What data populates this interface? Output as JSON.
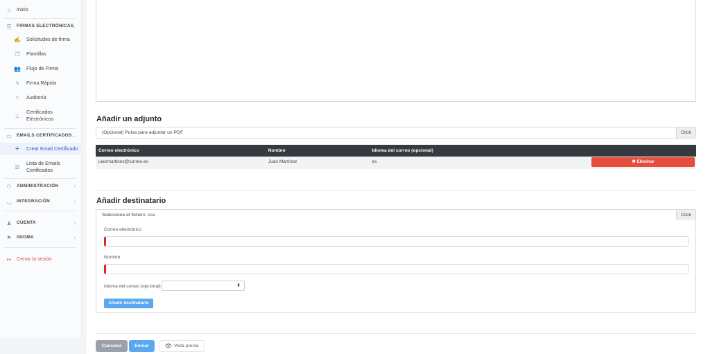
{
  "sidebar": {
    "items": [
      {
        "label": "Inicio",
        "icon": "home-icon"
      },
      {
        "label": "FIRMAS ELECTRÓNICAS",
        "icon": "list-icon"
      },
      {
        "label": "Solicitudes de firma",
        "icon": "signature-icon"
      },
      {
        "label": "Plantillas",
        "icon": "copy-icon"
      },
      {
        "label": "Flujo de Firma",
        "icon": "users-icon"
      },
      {
        "label": "Firma Rápida",
        "icon": "bolt-icon"
      },
      {
        "label": "Auditoría",
        "icon": "search-icon"
      },
      {
        "label": "Certificados Electrónicos",
        "icon": "certificate-icon"
      },
      {
        "label": "EMAILS CERTIFICADOS",
        "icon": "envelope-icon"
      },
      {
        "label": "Crear Email Certificado",
        "icon": "plus-icon"
      },
      {
        "label": "Lista de Emails Certificados",
        "icon": "list-icon"
      },
      {
        "label": "ADMINISTRACIÓN",
        "icon": "user-cog-icon"
      },
      {
        "label": "INTEGRACIÓN",
        "icon": "shield-icon"
      },
      {
        "label": "CUENTA",
        "icon": "user-icon"
      },
      {
        "label": "IDIOMA",
        "icon": "flag-icon"
      },
      {
        "label": "Cerrar la sesión",
        "icon": "logout-icon"
      }
    ]
  },
  "attachment": {
    "title": "Añadir un adjunto",
    "placeholder": "(Opcional) Pulsa para adjuntar un PDF",
    "button": "Click"
  },
  "recipients_table": {
    "headers": [
      "Correo electrónico",
      "Nombre",
      "Idioma del correo (opcional)",
      ""
    ],
    "rows": [
      {
        "email": "juanmartinez@correo.es",
        "name": "Juan Martínez",
        "language": "es",
        "action": "✖ Eliminar"
      }
    ]
  },
  "add_recipient": {
    "title": "Añadir destinatario",
    "file_placeholder": "Seleccione el fichero .csv",
    "button": "Click",
    "email_label": "Correo electrónico",
    "name_label": "Nombre",
    "language_label": "Idioma del correo (opcional)",
    "language_value": "",
    "submit": "Añadir destinatario"
  },
  "footer": {
    "cancel": "Cancelar",
    "send": "Enviar",
    "preview": "Vista previa"
  },
  "colors": {
    "accent": "#5aa9f0",
    "danger": "#e74c3c",
    "table_header": "#343a40",
    "active_nav": "#1f5fbf"
  }
}
